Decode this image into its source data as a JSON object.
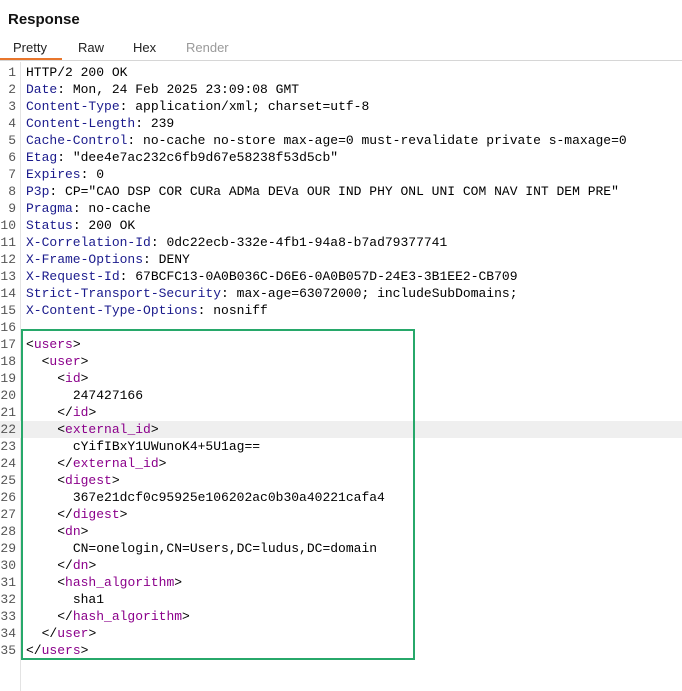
{
  "panel_title": "Response",
  "tabs": [
    {
      "label": "Pretty",
      "active": true
    },
    {
      "label": "Raw",
      "active": false
    },
    {
      "label": "Hex",
      "active": false
    },
    {
      "label": "Render",
      "active": false,
      "disabled": true
    }
  ],
  "status_line": "HTTP/2 200 OK",
  "headers": [
    {
      "name": "Date",
      "value": "Mon, 24 Feb 2025 23:09:08 GMT"
    },
    {
      "name": "Content-Type",
      "value": "application/xml; charset=utf-8"
    },
    {
      "name": "Content-Length",
      "value": "239"
    },
    {
      "name": "Cache-Control",
      "value": "no-cache no-store max-age=0 must-revalidate private s-maxage=0"
    },
    {
      "name": "Etag",
      "value": "\"dee4e7ac232c6fb9d67e58238f53d5cb\""
    },
    {
      "name": "Expires",
      "value": "0"
    },
    {
      "name": "P3p",
      "value": "CP=\"CAO DSP COR CURa ADMa DEVa OUR IND PHY ONL UNI COM NAV INT DEM PRE\""
    },
    {
      "name": "Pragma",
      "value": "no-cache"
    },
    {
      "name": "Status",
      "value": "200 OK"
    },
    {
      "name": "X-Correlation-Id",
      "value": "0dc22ecb-332e-4fb1-94a8-b7ad79377741"
    },
    {
      "name": "X-Frame-Options",
      "value": "DENY"
    },
    {
      "name": "X-Request-Id",
      "value": "67BCFC13-0A0B036C-D6E6-0A0B057D-24E3-3B1EE2-CB709"
    },
    {
      "name": "Strict-Transport-Security",
      "value": "max-age=63072000; includeSubDomains;"
    },
    {
      "name": "X-Content-Type-Options",
      "value": "nosniff"
    }
  ],
  "xml_body": [
    {
      "indent": 0,
      "kind": "open",
      "tag": "users"
    },
    {
      "indent": 1,
      "kind": "open",
      "tag": "user"
    },
    {
      "indent": 2,
      "kind": "open",
      "tag": "id"
    },
    {
      "indent": 3,
      "kind": "text",
      "text": "247427166"
    },
    {
      "indent": 2,
      "kind": "close",
      "tag": "id"
    },
    {
      "indent": 2,
      "kind": "open",
      "tag": "external_id"
    },
    {
      "indent": 3,
      "kind": "text",
      "text": "cYifIBxY1UWunoK4+5U1ag=="
    },
    {
      "indent": 2,
      "kind": "close",
      "tag": "external_id"
    },
    {
      "indent": 2,
      "kind": "open",
      "tag": "digest"
    },
    {
      "indent": 3,
      "kind": "text",
      "text": "367e21dcf0c95925e106202ac0b30a40221cafa4"
    },
    {
      "indent": 2,
      "kind": "close",
      "tag": "digest"
    },
    {
      "indent": 2,
      "kind": "open",
      "tag": "dn"
    },
    {
      "indent": 3,
      "kind": "text",
      "text": "CN=onelogin,CN=Users,DC=ludus,DC=domain"
    },
    {
      "indent": 2,
      "kind": "close",
      "tag": "dn"
    },
    {
      "indent": 2,
      "kind": "open",
      "tag": "hash_algorithm"
    },
    {
      "indent": 3,
      "kind": "text",
      "text": "sha1"
    },
    {
      "indent": 2,
      "kind": "close",
      "tag": "hash_algorithm"
    },
    {
      "indent": 1,
      "kind": "close",
      "tag": "user"
    },
    {
      "indent": 0,
      "kind": "close",
      "tag": "users"
    }
  ],
  "highlighted_xml_line": 5,
  "colors": {
    "accent_tab": "#e8762c",
    "header_name": "#1a1a8c",
    "xml_tag": "#8b008b",
    "selection_box": "#27a86a"
  }
}
